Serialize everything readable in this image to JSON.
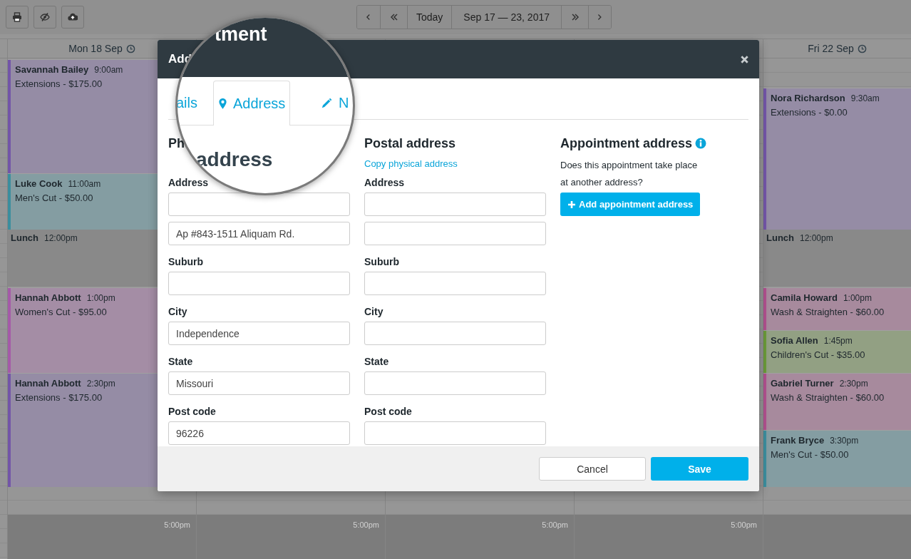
{
  "toolbar": {
    "today": "Today",
    "range": "Sep 17 — 23, 2017"
  },
  "calendar": {
    "days": [
      {
        "label": "Mon 18 Sep",
        "closing": "5:00pm",
        "events": [
          {
            "kind": "appointment",
            "name": "Savannah Bailey",
            "time": "9:00am",
            "service": "Extensions - $175.00",
            "color": "#7355a8"
          },
          {
            "kind": "appointment",
            "name": "Luke Cook",
            "time": "11:00am",
            "service": "Men's Cut - $50.00",
            "color": "#3b8e9e"
          },
          {
            "kind": "break",
            "name": "Lunch",
            "time": "12:00pm"
          },
          {
            "kind": "appointment",
            "name": "Hannah Abbott",
            "time": "1:00pm",
            "service": "Women's Cut - $95.00",
            "color": "#a55aa8"
          },
          {
            "kind": "appointment",
            "name": "Hannah Abbott",
            "time": "2:30pm",
            "service": "Extensions - $175.00",
            "color": "#7355a8"
          }
        ]
      },
      {
        "closing": "5:00pm"
      },
      {
        "closing": "5:00pm"
      },
      {
        "closing": "5:00pm"
      },
      {
        "label": "Fri 22 Sep",
        "events": [
          {
            "kind": "appointment",
            "name": "Nora Richardson",
            "time": "9:30am",
            "service": "Extensions - $0.00",
            "color": "#7355a8"
          },
          {
            "kind": "break",
            "name": "Lunch",
            "time": "12:00pm"
          },
          {
            "kind": "appointment",
            "name": "Camila Howard",
            "time": "1:00pm",
            "service": "Wash & Straighten - $60.00",
            "color": "#b0508e"
          },
          {
            "kind": "appointment",
            "name": "Sofia Allen",
            "time": "1:45pm",
            "service": "Children's Cut - $35.00",
            "color": "#6a9a38"
          },
          {
            "kind": "appointment",
            "name": "Gabriel Turner",
            "time": "2:30pm",
            "service": "Wash & Straighten - $60.00",
            "color": "#b0508e"
          },
          {
            "kind": "appointment",
            "name": "Frank Bryce",
            "time": "3:30pm",
            "service": "Men's Cut - $50.00",
            "color": "#3b8e9e"
          }
        ]
      }
    ]
  },
  "modal": {
    "title": "Add",
    "columns": [
      {
        "heading": "Ph",
        "items": [
          {
            "kind": "label",
            "text": "Address"
          },
          {
            "kind": "input"
          },
          {
            "kind": "input",
            "value": "Ap #843-1511 Aliquam Rd."
          },
          {
            "kind": "label",
            "text": "Suburb"
          },
          {
            "kind": "input"
          },
          {
            "kind": "label",
            "text": "City"
          },
          {
            "kind": "input",
            "value": "Independence"
          },
          {
            "kind": "label",
            "text": "State"
          },
          {
            "kind": "input",
            "value": "Missouri"
          },
          {
            "kind": "label",
            "text": "Post code"
          },
          {
            "kind": "input",
            "value": "96226"
          }
        ]
      },
      {
        "heading": "Postal address",
        "link": "Copy physical address",
        "items": [
          {
            "kind": "label",
            "text": "Address"
          },
          {
            "kind": "input"
          },
          {
            "kind": "input"
          },
          {
            "kind": "label",
            "text": "Suburb"
          },
          {
            "kind": "input"
          },
          {
            "kind": "label",
            "text": "City"
          },
          {
            "kind": "input"
          },
          {
            "kind": "label",
            "text": "State"
          },
          {
            "kind": "input"
          },
          {
            "kind": "label",
            "text": "Post code"
          },
          {
            "kind": "input"
          }
        ]
      }
    ],
    "appointment": {
      "heading": "Appointment address",
      "text": "Does this appointment take place at another address?",
      "button": "Add appointment address"
    },
    "buttons": [
      {
        "label": "Cancel",
        "kind": "secondary"
      },
      {
        "label": "Save",
        "kind": "primary"
      }
    ]
  },
  "magnifier": {
    "title": "tment",
    "tabs": [
      {
        "label": "ails",
        "kind": "details",
        "selected": false
      },
      {
        "label": "Address",
        "kind": "address",
        "selected": true
      },
      {
        "label": "N",
        "kind": "notes",
        "selected": false
      }
    ],
    "heading": "address"
  }
}
